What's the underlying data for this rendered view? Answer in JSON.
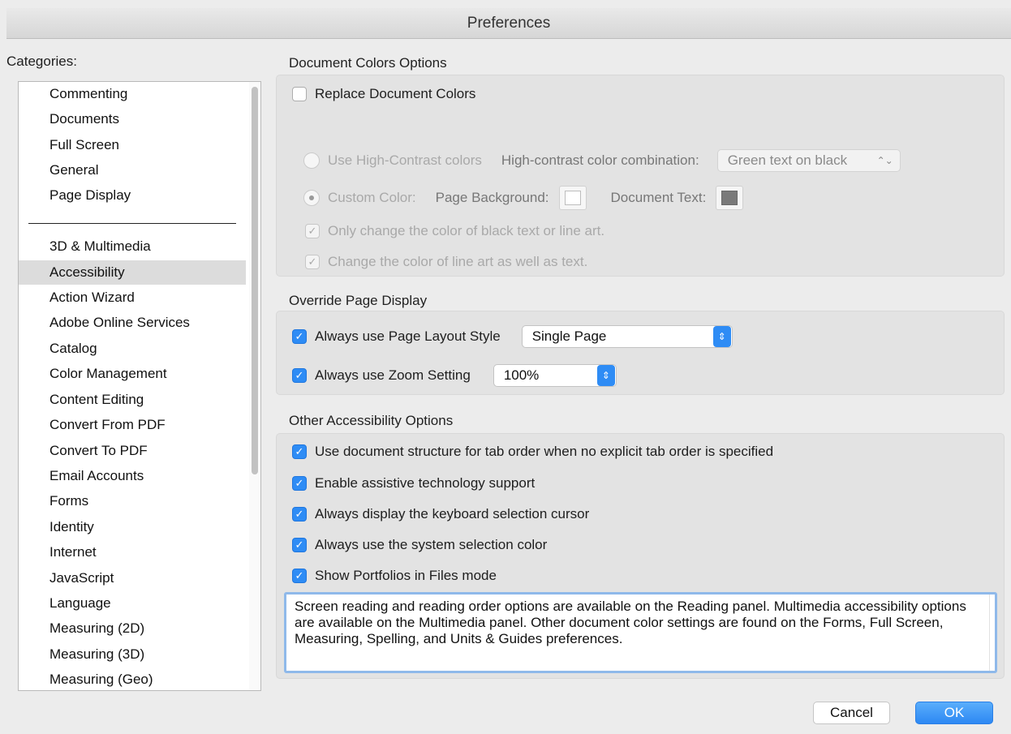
{
  "window": {
    "title": "Preferences"
  },
  "categories": {
    "label": "Categories:",
    "top_items": [
      "Commenting",
      "Documents",
      "Full Screen",
      "General",
      "Page Display"
    ],
    "items": [
      "3D & Multimedia",
      "Accessibility",
      "Action Wizard",
      "Adobe Online Services",
      "Catalog",
      "Color Management",
      "Content Editing",
      "Convert From PDF",
      "Convert To PDF",
      "Email Accounts",
      "Forms",
      "Identity",
      "Internet",
      "JavaScript",
      "Language",
      "Measuring (2D)",
      "Measuring (3D)",
      "Measuring (Geo)"
    ],
    "selected": "Accessibility"
  },
  "document_colors": {
    "title": "Document Colors Options",
    "replace_label": "Replace Document Colors",
    "replace_checked": false,
    "high_contrast_label": "Use High-Contrast colors",
    "combo_label": "High-contrast color combination:",
    "combo_value": "Green text on black",
    "custom_color_label": "Custom Color:",
    "page_bg_label": "Page Background:",
    "doc_text_label": "Document Text:",
    "page_bg_color": "#ffffff",
    "doc_text_color": "#7a7a7a",
    "only_black_label": "Only change the color of black text or line art.",
    "line_art_label": "Change the color of line art as well as text."
  },
  "override_page": {
    "title": "Override Page Display",
    "layout_label": "Always use Page Layout Style",
    "layout_value": "Single Page",
    "zoom_label": "Always use Zoom Setting",
    "zoom_value": "100%"
  },
  "other_options": {
    "title": "Other Accessibility Options",
    "items": [
      {
        "label": "Use document structure for tab order when no explicit tab order is specified",
        "checked": true
      },
      {
        "label": "Enable assistive technology support",
        "checked": true
      },
      {
        "label": "Always display the keyboard selection cursor",
        "checked": true
      },
      {
        "label": "Always use the system selection color",
        "checked": true
      },
      {
        "label": "Show Portfolios in Files mode",
        "checked": true
      }
    ],
    "info_text": "Screen reading and reading order options are available on the Reading panel. Multimedia accessibility options are available on the Multimedia panel. Other document color settings are found on the Forms, Full Screen, Measuring, Spelling, and Units & Guides preferences."
  },
  "buttons": {
    "cancel": "Cancel",
    "ok": "OK"
  },
  "colors": {
    "accent": "#2e8cf5",
    "selection": "#dcdcdc"
  }
}
